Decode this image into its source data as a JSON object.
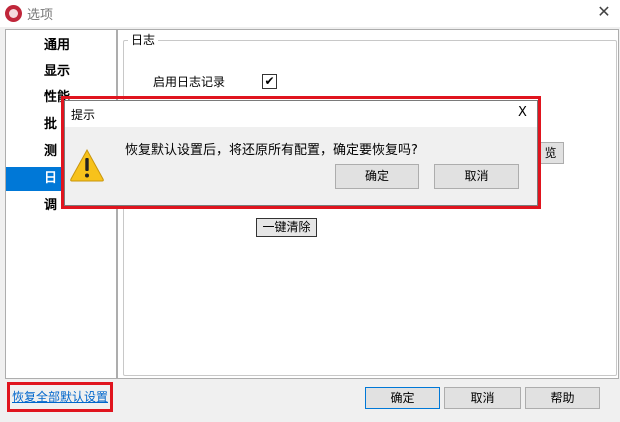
{
  "window": {
    "title": "选项",
    "close_symbol": "✕",
    "app_icon": "app-logo-icon"
  },
  "sidebar": {
    "items": [
      {
        "label": "通用",
        "selected": false
      },
      {
        "label": "显示",
        "selected": false
      },
      {
        "label": "性能",
        "selected": false
      },
      {
        "label": "批",
        "selected": false
      },
      {
        "label": "测",
        "selected": false
      },
      {
        "label": "日",
        "selected": true
      },
      {
        "label": "调",
        "selected": false
      }
    ],
    "selected_color": "#0078d7"
  },
  "main": {
    "group_title": "日志",
    "log_enable_label": "启用日志记录",
    "log_enable_checked": true,
    "check_symbol": "✔",
    "browse_button_partial": "览",
    "clear_button": "一键清除"
  },
  "footer": {
    "restore_link": "恢复全部默认设置",
    "ok": "确定",
    "cancel": "取消",
    "help": "帮助"
  },
  "dialog": {
    "title": "提示",
    "close_symbol": "X",
    "message": "恢复默认设置后，将还原所有配置，确定要恢复吗?",
    "ok": "确定",
    "cancel": "取消",
    "icon": "warning-icon",
    "warning_color": "#f7c21b"
  },
  "highlight_color": "#e0141e"
}
